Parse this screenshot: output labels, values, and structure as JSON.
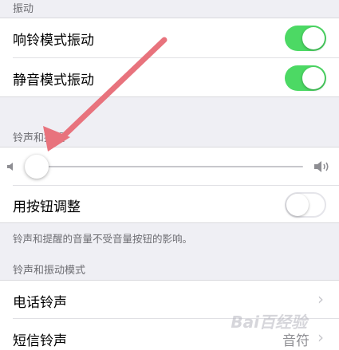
{
  "sections": {
    "vibrate_header": "振动",
    "ringer_header": "铃声和提醒",
    "pattern_header": "铃声和振动模式"
  },
  "vibrate": {
    "ring_label": "响铃模式振动",
    "ring_on": true,
    "silent_label": "静音模式振动",
    "silent_on": true
  },
  "ringer": {
    "volume_level": 0.05,
    "change_with_buttons_label": "用按钮调整",
    "change_with_buttons_on": false,
    "note": "铃声和提醒的音量不受音量按钮的影响。"
  },
  "patterns": {
    "ringtone_label": "电话铃声",
    "text_tone_label": "短信铃声",
    "text_tone_value": "音符"
  },
  "icons": {
    "volume_low": "speaker-low-icon",
    "volume_high": "speaker-high-icon",
    "chevron": "chevron-right-icon"
  },
  "colors": {
    "toggle_on": "#4cd964",
    "accent": "#007aff",
    "annotation_arrow": "#e8737d"
  }
}
